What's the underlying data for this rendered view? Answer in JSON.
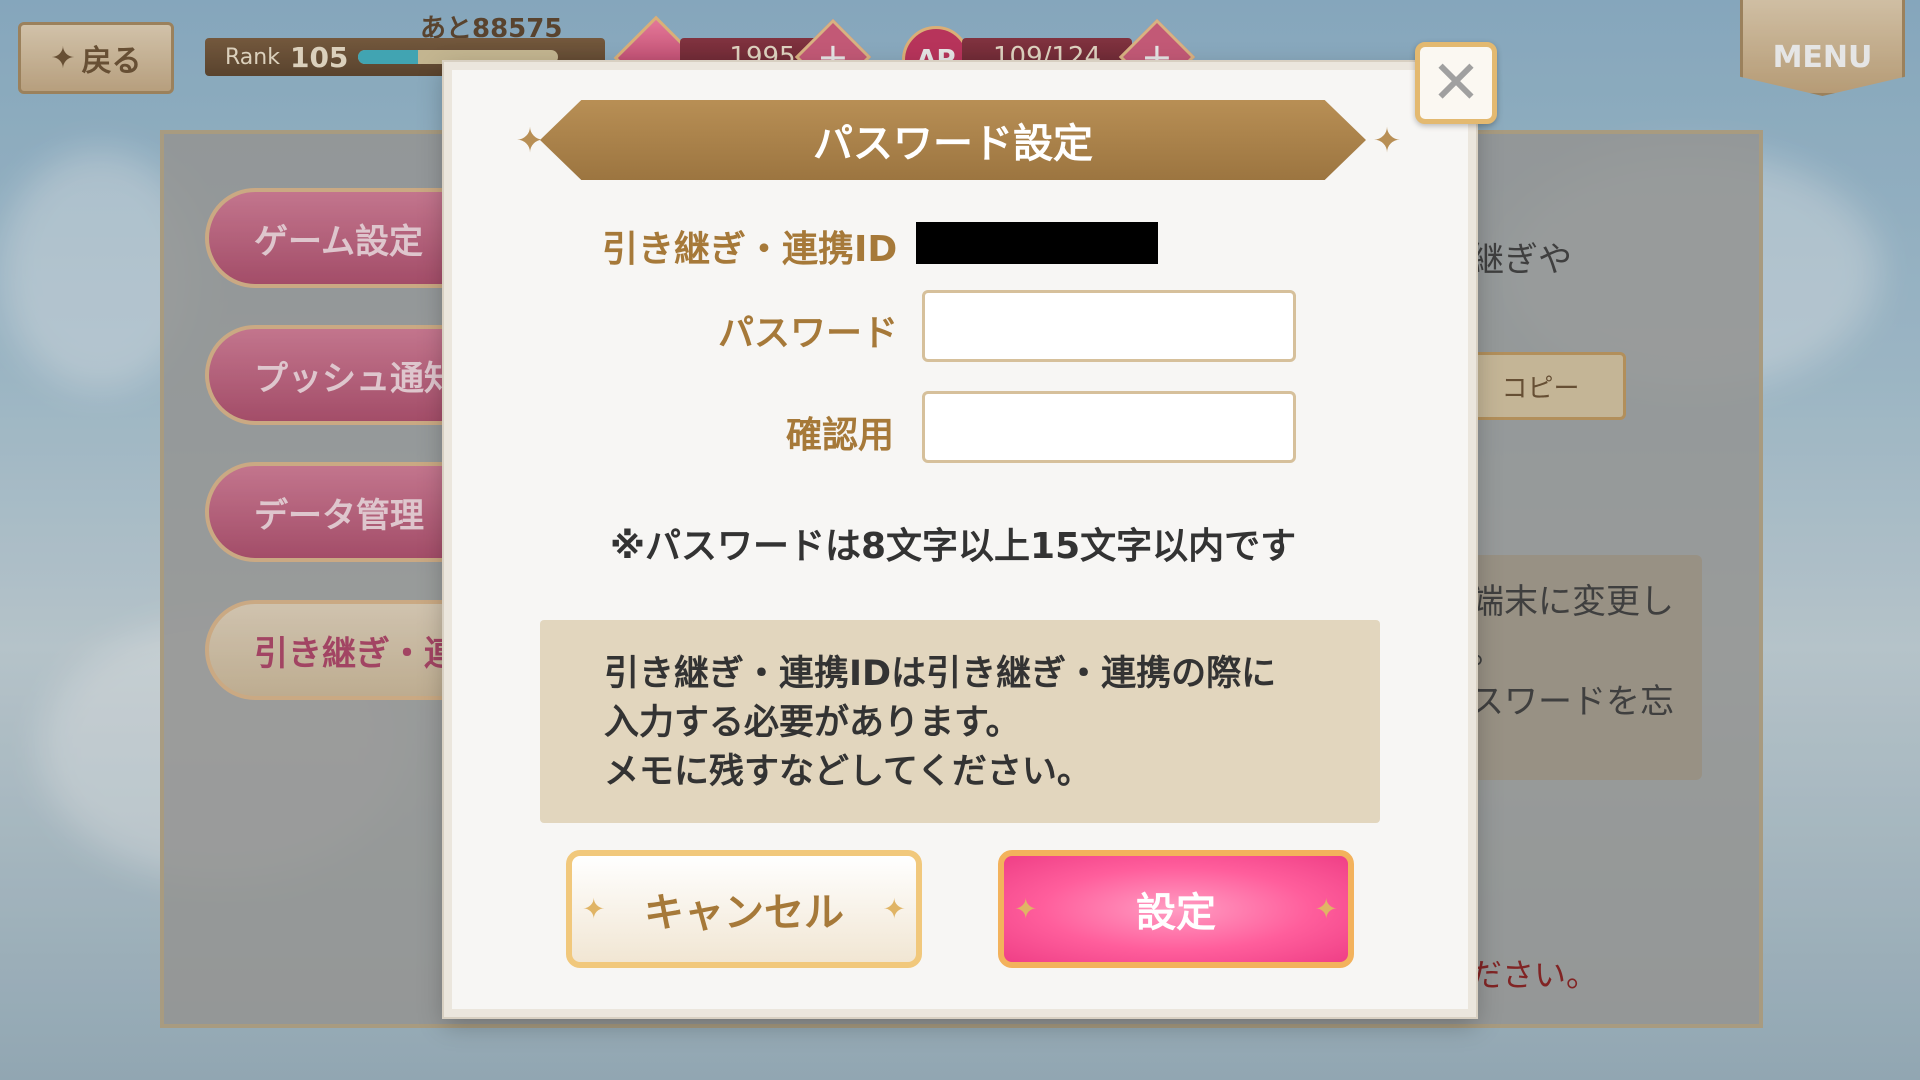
{
  "hud": {
    "back_label": "戻る",
    "rank_label": "Rank",
    "rank_value": "105",
    "rank_remaining": "あと88575",
    "rank_progress": 0.3,
    "gems": "1995",
    "ap_label": "AP",
    "ap_value": "109/124",
    "menu_label": "MENU",
    "plus": "+"
  },
  "background": {
    "menu_items": [
      "ゲーム設定",
      "プッシュ通知",
      "データ管理",
      "引き継ぎ・連"
    ],
    "text_top": "継ぎや",
    "copy_button": "コピー",
    "info_line1": "端末に変更し",
    "info_line2": "。",
    "info_line3": "スワードを忘",
    "red_text": "ださい。"
  },
  "modal": {
    "title": "パスワード設定",
    "close_symbol": "✕",
    "id_label": "引き継ぎ・連携ID",
    "password_label": "パスワード",
    "confirm_label": "確認用",
    "password_value": "",
    "confirm_value": "",
    "note": "※パスワードは8文字以上15文字以内です",
    "info_lines": [
      "引き継ぎ・連携IDは引き継ぎ・連携の際に",
      "入力する必要があります。",
      "メモに残すなどしてください。"
    ],
    "cancel_label": "キャンセル",
    "set_label": "設定"
  },
  "colors": {
    "accent_gold": "#b88f55",
    "label_brown": "#a67939",
    "pink_button": "#ff5e9c"
  }
}
